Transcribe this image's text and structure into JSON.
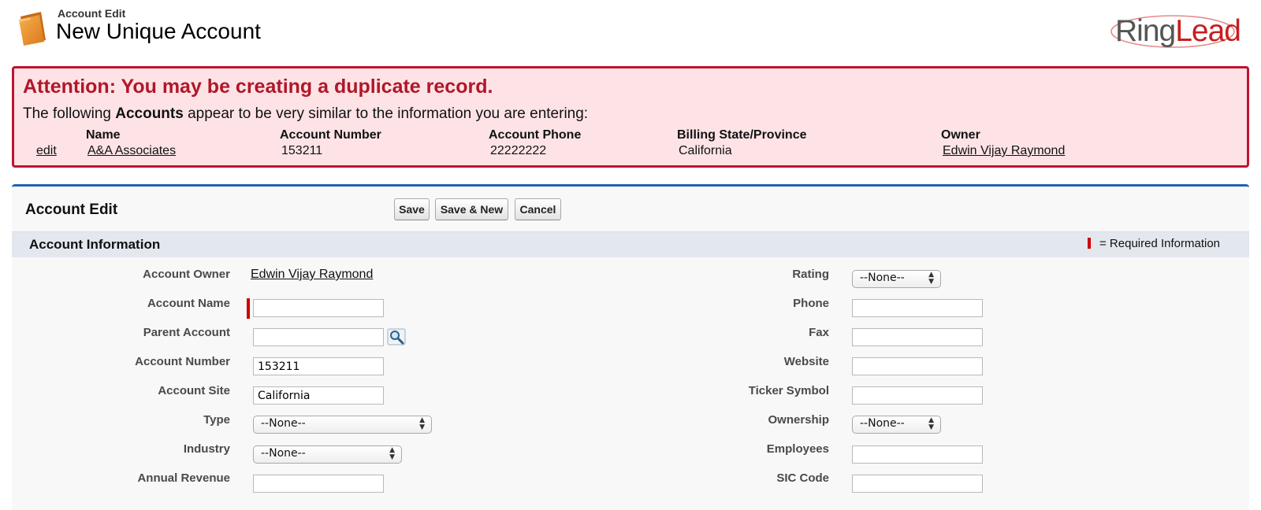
{
  "header": {
    "breadcrumb": "Account Edit",
    "title": "New Unique Account",
    "logo_ring": "Ring",
    "logo_lead": "Lead",
    "icon": "folder-icon"
  },
  "warning": {
    "title": "Attention: You may be creating a duplicate record.",
    "text_before": "The following ",
    "text_bold": "Accounts",
    "text_after": " appear to be very similar to the information you are entering:",
    "columns": [
      "Name",
      "Account Number",
      "Account Phone",
      "Billing State/Province",
      "Owner"
    ],
    "row": {
      "action": "edit",
      "name": "A&A Associates",
      "account_number": "153211",
      "account_phone": "22222222",
      "billing_state": "California",
      "owner": "Edwin Vijay Raymond"
    },
    "border_color": "#c0132f",
    "background": "#fde3e6"
  },
  "edit": {
    "title": "Account Edit",
    "buttons": {
      "save": "Save",
      "save_new": "Save & New",
      "cancel": "Cancel"
    },
    "section_title": "Account Information",
    "required_legend": "= Required Information",
    "accent": "#1f63b3",
    "left_fields": {
      "account_owner": {
        "label": "Account Owner",
        "value": "Edwin Vijay Raymond"
      },
      "account_name": {
        "label": "Account Name",
        "value": ""
      },
      "parent_account": {
        "label": "Parent Account",
        "value": "",
        "icon": "lookup-icon"
      },
      "account_number": {
        "label": "Account Number",
        "value": "153211"
      },
      "account_site": {
        "label": "Account Site",
        "value": "California"
      },
      "type": {
        "label": "Type",
        "value": "--None--"
      },
      "industry": {
        "label": "Industry",
        "value": "--None--"
      },
      "annual_revenue": {
        "label": "Annual Revenue",
        "value": ""
      }
    },
    "right_fields": {
      "rating": {
        "label": "Rating",
        "value": "--None--"
      },
      "phone": {
        "label": "Phone",
        "value": ""
      },
      "fax": {
        "label": "Fax",
        "value": ""
      },
      "website": {
        "label": "Website",
        "value": ""
      },
      "ticker_symbol": {
        "label": "Ticker Symbol",
        "value": ""
      },
      "ownership": {
        "label": "Ownership",
        "value": "--None--"
      },
      "employees": {
        "label": "Employees",
        "value": ""
      },
      "sic_code": {
        "label": "SIC Code",
        "value": ""
      }
    }
  }
}
